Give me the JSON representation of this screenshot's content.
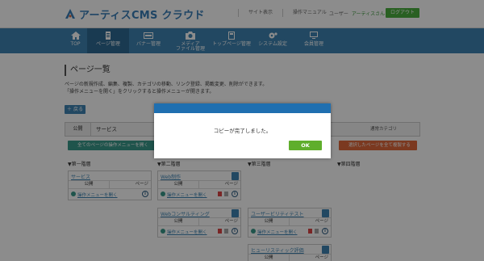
{
  "header": {
    "logo_text": "アーティスCMS クラウド",
    "links": [
      "サイト表示",
      "操作マニュアル"
    ],
    "user_label": "ユーザー",
    "user_name": "アーティスさん",
    "logout_label": "ログアウト"
  },
  "nav": {
    "items": [
      {
        "label": "TOP",
        "icon": "home-icon"
      },
      {
        "label": "ページ管理",
        "icon": "document-icon",
        "active": true
      },
      {
        "label": "バナー管理",
        "icon": "banner-icon"
      },
      {
        "label": "メディア\nファイル管理",
        "icon": "camera-icon"
      },
      {
        "label": "トップページ管理",
        "icon": "toppage-icon"
      },
      {
        "label": "システム設定",
        "icon": "gear-icon"
      },
      {
        "label": "会員管理",
        "icon": "monitor-icon"
      }
    ],
    "active_color": "#2e6a94",
    "bar_color": "#3e84b3"
  },
  "main": {
    "page_title": "ページ一覧",
    "desc_line1": "ページの新規作成、編集、複製、カテゴリの移動、リンク登録、掲載変更、削除ができます。",
    "desc_line2": "「操作メニューを開く」をクリックすると操作メニューが開きます。",
    "back_label": "＋ 戻る",
    "filter_label": "公開",
    "filter_value": "サービス",
    "filter_right": "通常カテゴリ",
    "expand_all_label": "全てのページの操作メニューを開く",
    "copy_selected_label": "選択したページを全て複製する",
    "levels": [
      "▼第一階層",
      "▼第二階層",
      "▼第三階層",
      "▼第四階層"
    ],
    "status_public": "公開",
    "page_type": "ページ",
    "open_ops_label": "操作メニューを開く",
    "cards": [
      {
        "title": "サービス"
      },
      {
        "title": "Web制作"
      },
      {
        "title": "Webコンサルティング"
      },
      {
        "title": "ユーザービリティテスト"
      },
      {
        "title": "ヒューリスティック評価"
      }
    ]
  },
  "modal": {
    "message": "コピーが完了しました。",
    "ok_label": "OK",
    "header_color": "#1f6fb0",
    "ok_color": "#5fae2c"
  }
}
